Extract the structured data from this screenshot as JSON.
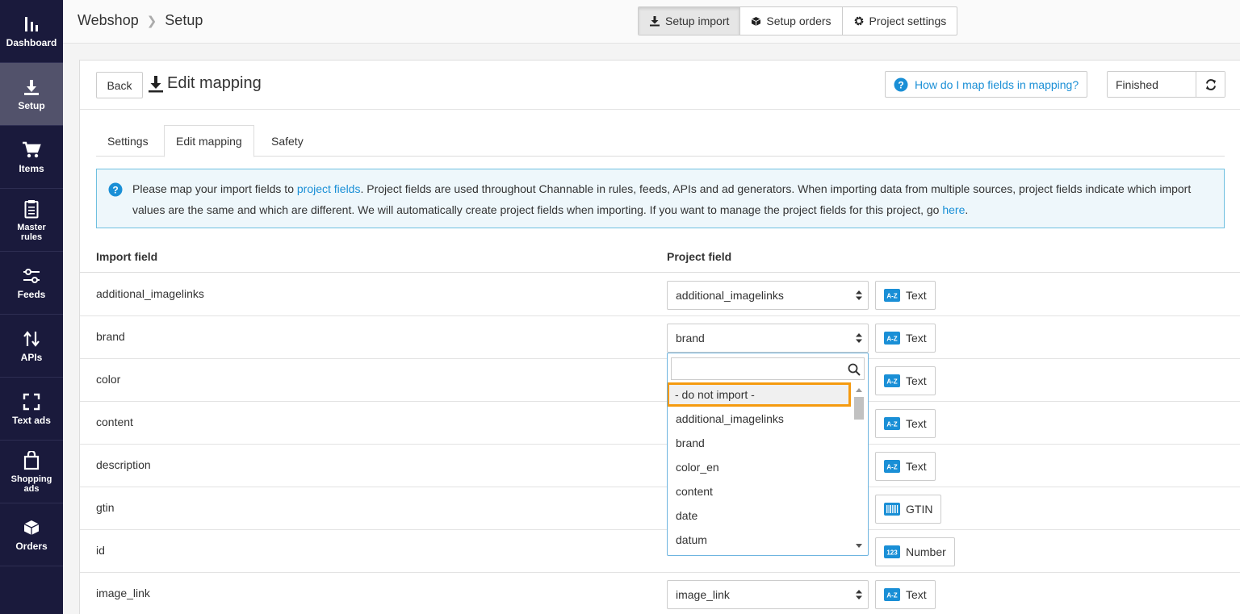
{
  "sidebar": {
    "items": [
      {
        "label": "Dashboard",
        "icon": "bar-chart-icon"
      },
      {
        "label": "Setup",
        "icon": "download-icon"
      },
      {
        "label": "Items",
        "icon": "cart-icon"
      },
      {
        "label": "Master\nrules",
        "icon": "clipboard-icon"
      },
      {
        "label": "Feeds",
        "icon": "sliders-icon"
      },
      {
        "label": "APIs",
        "icon": "arrows-updown-icon"
      },
      {
        "label": "Text ads",
        "icon": "frame-icon"
      },
      {
        "label": "Shopping\nads",
        "icon": "bag-icon"
      },
      {
        "label": "Orders",
        "icon": "box-icon"
      }
    ]
  },
  "topbar": {
    "breadcrumb": [
      "Webshop",
      "Setup"
    ],
    "buttons": [
      "Setup import",
      "Setup orders",
      "Project settings"
    ]
  },
  "panel": {
    "back_label": "Back",
    "title": "Edit mapping",
    "help_label": "How do I map fields in mapping?",
    "status": "Finished"
  },
  "tabs": [
    "Settings",
    "Edit mapping",
    "Safety"
  ],
  "info": {
    "text_1": "Please map your import fields to ",
    "link_1": "project fields",
    "text_2": ". Project fields are used throughout Channable in rules, feeds, APIs and ad generators. When importing data from multiple sources, project fields indicate which import values are the same and which are different. We will automatically create project fields when importing. If you want to manage the project fields for this project, go ",
    "link_2": "here",
    "text_3": "."
  },
  "table": {
    "headers": [
      "Import field",
      "Project field"
    ],
    "rows": [
      {
        "field": "additional_imagelinks",
        "project": "additional_imagelinks",
        "type": "Text",
        "type_icon": "az-icon"
      },
      {
        "field": "brand",
        "project": "brand",
        "type": "Text",
        "type_icon": "az-icon"
      },
      {
        "field": "color",
        "project": "",
        "type": "Text",
        "type_icon": "az-icon"
      },
      {
        "field": "content",
        "project": "",
        "type": "Text",
        "type_icon": "az-icon"
      },
      {
        "field": "description",
        "project": "",
        "type": "Text",
        "type_icon": "az-icon"
      },
      {
        "field": "gtin",
        "project": "",
        "type": "GTIN",
        "type_icon": "barcode-icon"
      },
      {
        "field": "id",
        "project": "",
        "type": "Number",
        "type_icon": "number-icon"
      },
      {
        "field": "image_link",
        "project": "image_link",
        "type": "Text",
        "type_icon": "az-icon"
      }
    ]
  },
  "dropdown": {
    "search_value": "",
    "options": [
      "- do not import -",
      "additional_imagelinks",
      "brand",
      "color_en",
      "content",
      "date",
      "datum"
    ],
    "highlighted": 0
  },
  "icons": {
    "az": "A-Z",
    "number": "123"
  },
  "colors": {
    "sidebar": "#1a1a3c",
    "sidebar_active": "#52526b",
    "accent": "#1a8fd6",
    "highlight": "#f59a0f"
  }
}
